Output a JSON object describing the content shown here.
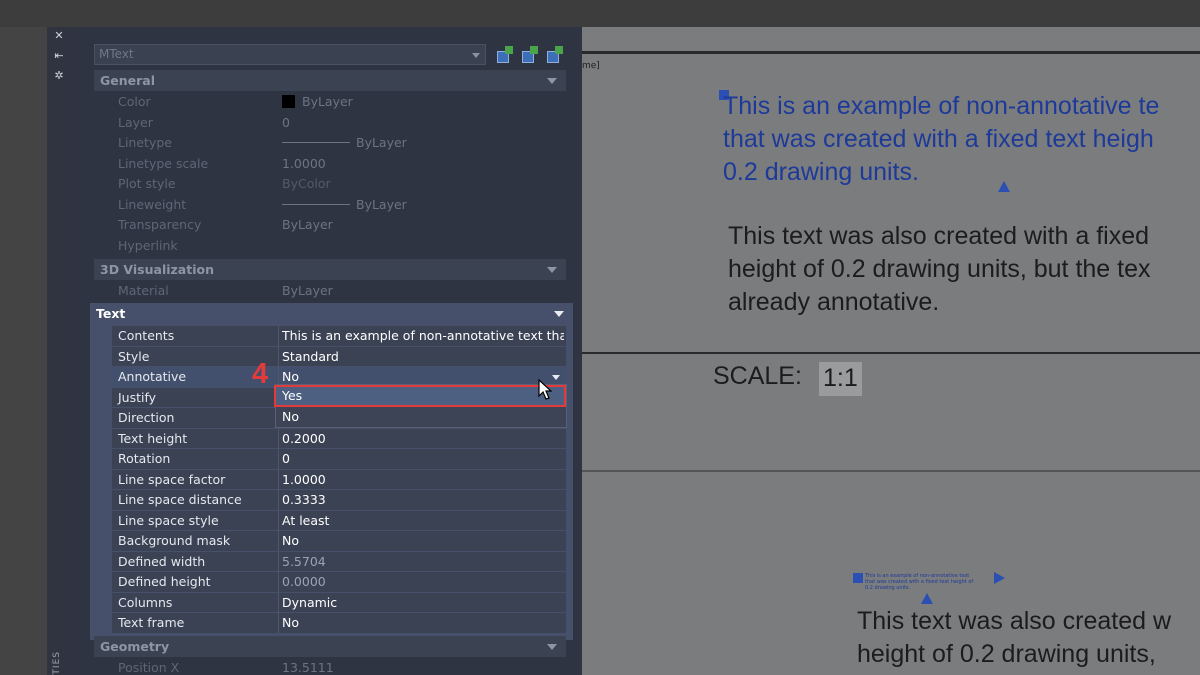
{
  "palette": {
    "object_type": "MText",
    "sections": {
      "general": "General",
      "visualization": "3D Visualization",
      "text": "Text",
      "geometry": "Geometry"
    },
    "side_label": "TIES",
    "general_rows": [
      {
        "label": "Color",
        "value": "ByLayer"
      },
      {
        "label": "Layer",
        "value": "0"
      },
      {
        "label": "Linetype",
        "value": "ByLayer"
      },
      {
        "label": "Linetype scale",
        "value": "1.0000"
      },
      {
        "label": "Plot style",
        "value": "ByColor"
      },
      {
        "label": "Lineweight",
        "value": "ByLayer"
      },
      {
        "label": "Transparency",
        "value": "ByLayer"
      },
      {
        "label": "Hyperlink",
        "value": ""
      }
    ],
    "visualization_rows": [
      {
        "label": "Material",
        "value": "ByLayer"
      }
    ],
    "text_rows": [
      {
        "label": "Contents",
        "value": "This is an example of non-annotative text that..."
      },
      {
        "label": "Style",
        "value": "Standard"
      },
      {
        "label": "Annotative",
        "value": "No"
      },
      {
        "label": "Justify",
        "value": ""
      },
      {
        "label": "Direction",
        "value": ""
      },
      {
        "label": "Text height",
        "value": "0.2000"
      },
      {
        "label": "Rotation",
        "value": "0"
      },
      {
        "label": "Line space factor",
        "value": "1.0000"
      },
      {
        "label": "Line space distance",
        "value": "0.3333"
      },
      {
        "label": "Line space style",
        "value": "At least"
      },
      {
        "label": "Background mask",
        "value": "No"
      },
      {
        "label": "Defined width",
        "value": "5.5704"
      },
      {
        "label": "Defined height",
        "value": "0.0000"
      },
      {
        "label": "Columns",
        "value": "Dynamic"
      },
      {
        "label": "Text frame",
        "value": "No"
      }
    ],
    "geometry_rows": [
      {
        "label": "Position X",
        "value": "13.5111"
      }
    ],
    "dropdown_options": [
      "Yes",
      "No"
    ]
  },
  "annotation": {
    "step": "4",
    "highlight_color": "#e33b3b"
  },
  "drawing": {
    "frame_note": "me]",
    "text_selected": "This is an example of non-annotative te\nthat was created with a fixed text heigh\n0.2 drawing units.",
    "text_plain": "This text was also created with a fixed\nheight of 0.2 drawing units, but the tex\nalready annotative.",
    "scale_label": "SCALE:",
    "scale_value": "1:1",
    "tiny_text": "This is an example of non-annotative text\nthat was created with a fixed text height of\n0.2 drawing units.",
    "lower_text": "This text was also created w\nheight of 0.2 drawing units,"
  },
  "colors": {
    "palette_bg": "#2e3441",
    "selection_blue": "#2b4fb3",
    "canvas_bg": "#7b7c7e"
  }
}
